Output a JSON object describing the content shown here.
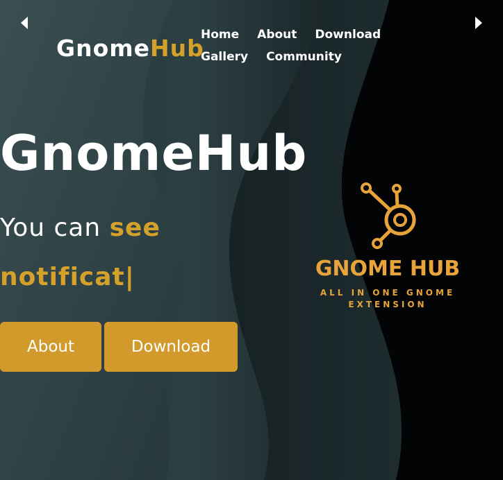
{
  "nav": {
    "brand_primary": "Gnome",
    "brand_accent": "Hub",
    "links": [
      "Home",
      "About",
      "Download",
      "Gallery",
      "Community"
    ]
  },
  "hero": {
    "title": "GnomeHub",
    "line_prefix": "You can ",
    "line_highlight": "see",
    "typed_text": "notificat|",
    "buttons": {
      "about": "About",
      "download": "Download"
    }
  },
  "logo": {
    "title": "GNOME HUB",
    "tagline_line1": "ALL IN ONE GNOME",
    "tagline_line2": "EXTENSION",
    "icon": "hub-network-icon"
  },
  "carousel": {
    "prev_icon": "chevron-left-icon",
    "next_icon": "chevron-right-icon"
  },
  "colors": {
    "accent": "#d4a12a",
    "button": "#d19a2a",
    "background_dark": "#020405",
    "background_teal": "#2a3c40",
    "text": "#ffffff"
  }
}
